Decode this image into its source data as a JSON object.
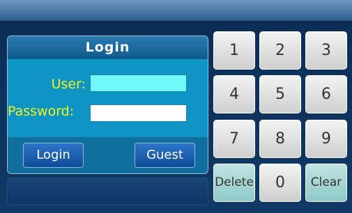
{
  "login": {
    "title": "Login",
    "user_label": "User:",
    "password_label": "Password:",
    "user_value": "",
    "password_value": "",
    "login_button": "Login",
    "guest_button": "Guest"
  },
  "keypad": {
    "keys": [
      "1",
      "2",
      "3",
      "4",
      "5",
      "6",
      "7",
      "8",
      "9",
      "Delete",
      "0",
      "Clear"
    ]
  },
  "colors": {
    "user_field": "#6ff7f9",
    "label_text": "#f1f31c",
    "panel_blue": "#0e95c3",
    "key_gray": "#e0e0e0",
    "key_teal": "#a8d6d4"
  }
}
